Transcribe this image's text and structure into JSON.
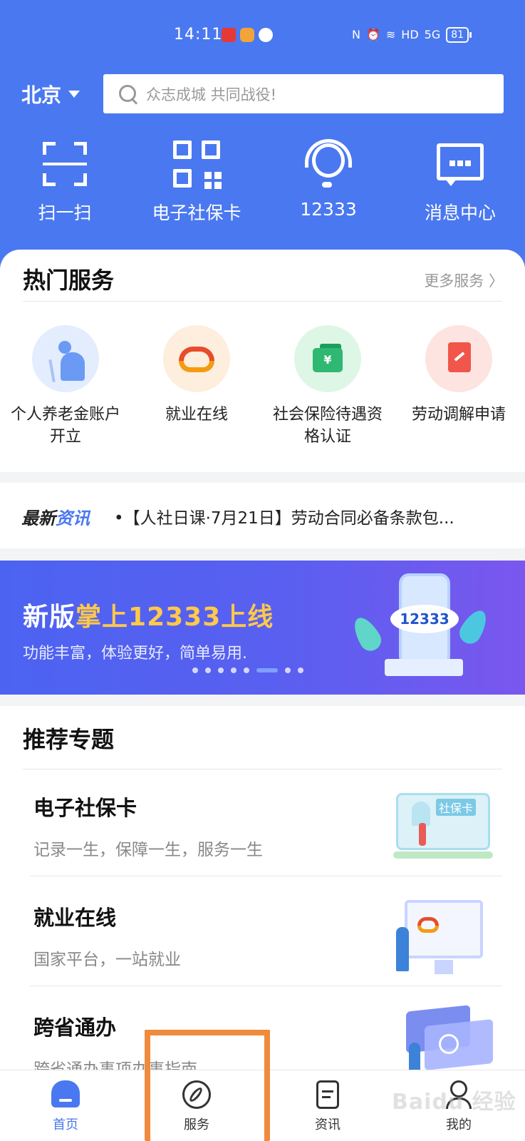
{
  "status_bar": {
    "time": "14:11",
    "signal_label": "5G",
    "hd_label": "HD",
    "battery": "81"
  },
  "header": {
    "city": "北京",
    "search_placeholder": "众志成城 共同战役!",
    "quick_actions": [
      {
        "label": "扫一扫",
        "icon": "scan-icon"
      },
      {
        "label": "电子社保卡",
        "icon": "qr-code-icon"
      },
      {
        "label": "12333",
        "icon": "headset-icon"
      },
      {
        "label": "消息中心",
        "icon": "message-icon"
      }
    ]
  },
  "hot_services": {
    "title": "热门服务",
    "more": "更多服务 〉",
    "items": [
      {
        "label": "个人养老金账户开立",
        "icon": "pension-icon",
        "color": "#e3edfd"
      },
      {
        "label": "就业在线",
        "icon": "employment-icon",
        "color": "#fdeedd"
      },
      {
        "label": "社会保险待遇资格认证",
        "icon": "insurance-card-icon",
        "color": "#def6e6"
      },
      {
        "label": "劳动调解申请",
        "icon": "document-edit-icon",
        "color": "#fde4e1"
      }
    ]
  },
  "news": {
    "tag_prefix": "最新",
    "tag_suffix": "资讯",
    "headline": "•【人社日课·7月21日】劳动合同必备条款包..."
  },
  "banner": {
    "title_plain": "新版",
    "title_highlight": "掌上12333上线",
    "subtitle": "功能丰富，体验更好，简单易用.",
    "art_text": "12333",
    "slides_count": 8,
    "active_slide": 6
  },
  "recommended": {
    "title": "推荐专题",
    "items": [
      {
        "title": "电子社保卡",
        "desc": "记录一生，保障一生，服务一生",
        "art_label": "社保卡"
      },
      {
        "title": "就业在线",
        "desc": "国家平台，一站就业"
      },
      {
        "title": "跨省通办",
        "desc": "跨省通办事项办事指南"
      }
    ]
  },
  "bottom_nav": {
    "items": [
      {
        "label": "首页",
        "icon": "home-icon",
        "active": true
      },
      {
        "label": "服务",
        "icon": "compass-icon",
        "active": false
      },
      {
        "label": "资讯",
        "icon": "news-doc-icon",
        "active": false
      },
      {
        "label": "我的",
        "icon": "user-icon",
        "active": false
      }
    ]
  },
  "watermark": "Baidu 经验",
  "colors": {
    "primary": "#4a78f0",
    "highlight": "#ffc94a",
    "annotation": "#f08a3c"
  }
}
